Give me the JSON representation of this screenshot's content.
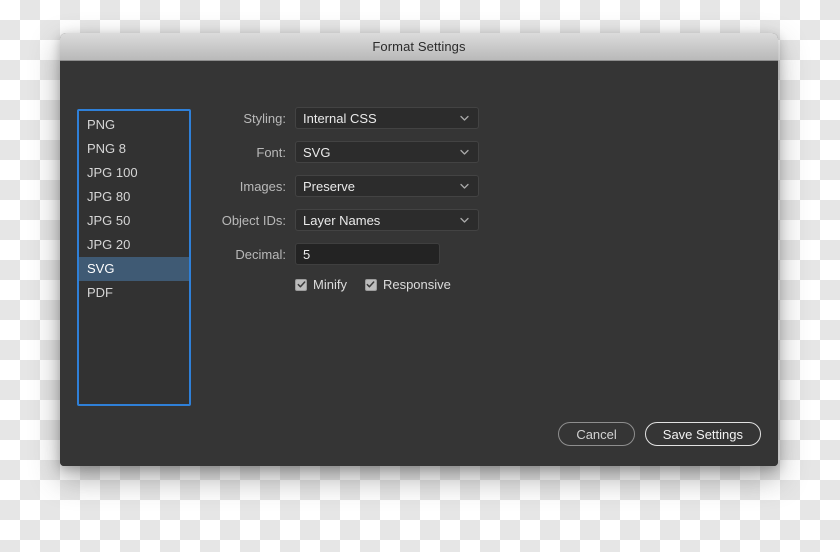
{
  "window": {
    "title": "Format Settings"
  },
  "format_list": {
    "name": "format-presets",
    "selected": "SVG",
    "items": [
      {
        "label": "PNG",
        "selected": false
      },
      {
        "label": "PNG 8",
        "selected": false
      },
      {
        "label": "JPG 100",
        "selected": false
      },
      {
        "label": "JPG 80",
        "selected": false
      },
      {
        "label": "JPG 50",
        "selected": false
      },
      {
        "label": "JPG 20",
        "selected": false
      },
      {
        "label": "SVG",
        "selected": true
      },
      {
        "label": "PDF",
        "selected": false
      }
    ]
  },
  "form": {
    "styling": {
      "label": "Styling:",
      "value": "Internal CSS"
    },
    "font": {
      "label": "Font:",
      "value": "SVG"
    },
    "images": {
      "label": "Images:",
      "value": "Preserve"
    },
    "object_ids": {
      "label": "Object IDs:",
      "value": "Layer Names"
    },
    "decimal": {
      "label": "Decimal:",
      "value": "5"
    },
    "minify": {
      "label": "Minify",
      "checked": true
    },
    "responsive": {
      "label": "Responsive",
      "checked": true
    }
  },
  "footer": {
    "cancel_label": "Cancel",
    "save_label": "Save Settings"
  },
  "colors": {
    "dialog_bg": "#353535",
    "titlebar_top": "#dcdcdc",
    "titlebar_bottom": "#b9b9b9",
    "list_focus_border": "#2f80d8",
    "list_selection": "#3f5a74",
    "field_bg": "#2c2c2c",
    "label_text": "#b9b9b9",
    "value_text": "#eaeaea"
  }
}
